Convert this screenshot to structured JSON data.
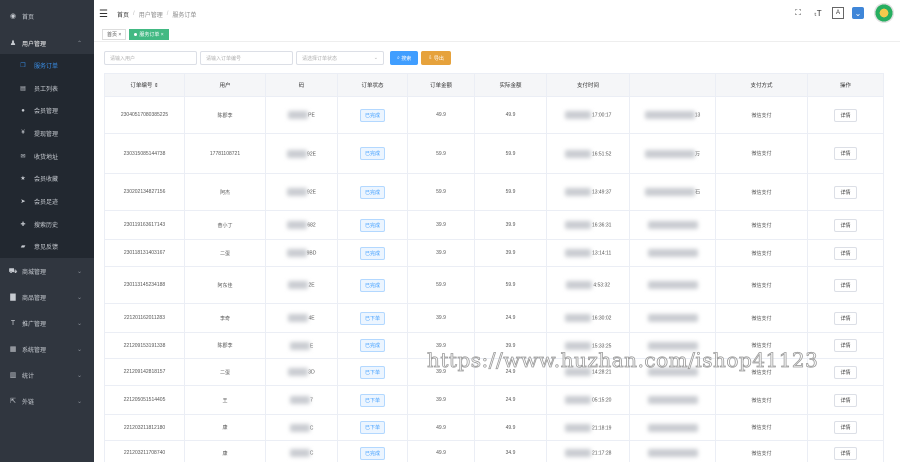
{
  "sidebar": {
    "items": [
      {
        "label": "首页",
        "icon": "dashboard-icon"
      },
      {
        "label": "用户管理",
        "icon": "user-icon",
        "expanded": true,
        "children": [
          {
            "label": "服务订单",
            "icon": "bookmark-icon",
            "active": true
          },
          {
            "label": "员工列表",
            "icon": "list-icon"
          },
          {
            "label": "会员管理",
            "icon": "member-icon"
          },
          {
            "label": "提现管理",
            "icon": "yen-icon"
          },
          {
            "label": "收货地址",
            "icon": "mail-icon"
          },
          {
            "label": "会员收藏",
            "icon": "star-icon"
          },
          {
            "label": "会员足迹",
            "icon": "send-icon"
          },
          {
            "label": "搜索历史",
            "icon": "plus-icon"
          },
          {
            "label": "意见反馈",
            "icon": "comment-icon"
          }
        ]
      },
      {
        "label": "商城管理",
        "icon": "cart-icon"
      },
      {
        "label": "商品管理",
        "icon": "folder-icon"
      },
      {
        "label": "推广管理",
        "icon": "font-icon"
      },
      {
        "label": "系统管理",
        "icon": "grid-icon"
      },
      {
        "label": "统计",
        "icon": "chart-icon"
      },
      {
        "label": "外链",
        "icon": "external-link-icon"
      }
    ]
  },
  "header": {
    "breadcrumb": [
      "首页",
      "用户管理",
      "服务订单"
    ],
    "icons": [
      "fullscreen-icon",
      "font-size-icon",
      "translate-icon",
      "dropdown-icon"
    ]
  },
  "tags": [
    {
      "label": "首页"
    },
    {
      "label": "服务订单",
      "active": true
    }
  ],
  "filters": {
    "user_placeholder": "请输入用户",
    "order_placeholder": "请输入订单编号",
    "status_placeholder": "请选择订单状态",
    "search_label": "搜索",
    "export_label": "导出"
  },
  "table": {
    "headers": [
      "订单编号",
      "用户",
      "手机号码",
      "订单状态",
      "订单金额",
      "实际金额",
      "支付时间",
      "",
      "支付方式",
      "操作"
    ],
    "visible_headers": [
      "订单编号 ⇕",
      "用户",
      "码",
      "订单状态",
      "订单金额",
      "实际金额",
      "支付时间",
      "",
      "支付方式",
      "操作"
    ],
    "rows": [
      {
        "order": "23040517080385225",
        "user": "陈郡李",
        "phone": "PE",
        "status": "已完成",
        "amount": "49.9",
        "actual": "49.9",
        "paytime": "17:00:17",
        "addr": "13",
        "paytype": "微信支付",
        "action": "详情"
      },
      {
        "order": "230315085144738",
        "user": "17781108721",
        "phone": "92E",
        "status": "已完成",
        "amount": "59.9",
        "actual": "59.9",
        "paytime": "16:51:52",
        "addr": "万",
        "paytype": "微信支付",
        "action": "详情"
      },
      {
        "order": "230202134827156",
        "user": "阿杰",
        "phone": "92E",
        "status": "已完成",
        "amount": "59.9",
        "actual": "59.9",
        "paytime": "13:49:37",
        "addr": "石",
        "paytype": "微信支付",
        "action": "详情"
      },
      {
        "order": "230119163617143",
        "user": "奋小丁",
        "phone": "682",
        "status": "已完成",
        "amount": "39.9",
        "actual": "39.9",
        "paytime": "16:36:31",
        "addr": "",
        "paytype": "微信支付",
        "action": "详情"
      },
      {
        "order": "230118131403167",
        "user": "二蛋",
        "phone": "9BD",
        "status": "已完成",
        "amount": "39.9",
        "actual": "39.9",
        "paytime": "13:14:11",
        "addr": "",
        "paytype": "微信支付",
        "action": "详情"
      },
      {
        "order": "230113145234188",
        "user": "阿东佳",
        "phone": "2E",
        "status": "已完成",
        "amount": "59.9",
        "actual": "59.9",
        "paytime": "4:53:32",
        "addr": "",
        "paytype": "微信支付",
        "action": "详情"
      },
      {
        "order": "221201162011283",
        "user": "李奇",
        "phone": "4E",
        "status": "已下单",
        "amount": "39.9",
        "actual": "24.9",
        "paytime": "16:30:02",
        "addr": "",
        "paytype": "微信支付",
        "action": "详情"
      },
      {
        "order": "221209153191338",
        "user": "陈郡李",
        "phone": "E",
        "status": "已完成",
        "amount": "39.9",
        "actual": "39.9",
        "paytime": "15:33:25",
        "addr": "",
        "paytype": "微信支付",
        "action": "详情"
      },
      {
        "order": "221209142818157",
        "user": "二蛋",
        "phone": "3D",
        "status": "已下单",
        "amount": "39.9",
        "actual": "24.9",
        "paytime": "14:28:21",
        "addr": "",
        "paytype": "微信支付",
        "action": "详情"
      },
      {
        "order": "221205051514405",
        "user": "王",
        "phone": "7",
        "status": "已下单",
        "amount": "39.9",
        "actual": "24.9",
        "paytime": "05:15:20",
        "addr": "",
        "paytype": "微信支付",
        "action": "详情"
      },
      {
        "order": "221203211812180",
        "user": "康",
        "phone": "C",
        "status": "已下单",
        "amount": "49.9",
        "actual": "49.9",
        "paytime": "21:18:19",
        "addr": "",
        "paytype": "微信支付",
        "action": "详情"
      },
      {
        "order": "221203211708740",
        "user": "康",
        "phone": "C",
        "status": "已完成",
        "amount": "49.9",
        "actual": "34.9",
        "paytime": "21:17:28",
        "addr": "",
        "paytype": "微信支付",
        "action": "详情"
      }
    ]
  },
  "watermark": "https://www.huzhan.com/ishop41123"
}
